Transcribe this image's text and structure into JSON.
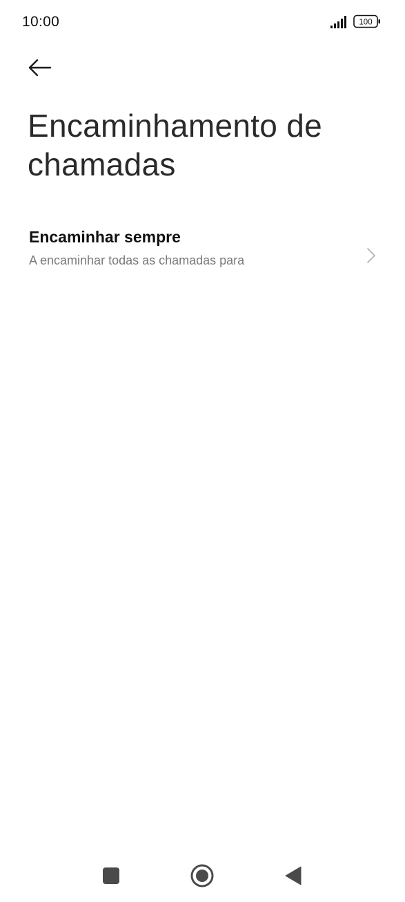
{
  "status_bar": {
    "time": "10:00",
    "signal_icon": "signal-bars-icon",
    "battery_level": "100",
    "battery_icon": "battery-icon"
  },
  "header": {
    "back_icon": "arrow-left-icon",
    "title": "Encaminhamento de chamadas"
  },
  "settings": {
    "items": [
      {
        "title": "Encaminhar sempre",
        "subtitle": "A encaminhar todas as chamadas para",
        "icon": "chevron-right-icon"
      }
    ]
  },
  "nav_bar": {
    "recents_icon": "square-icon",
    "home_icon": "circle-icon",
    "back_icon": "triangle-back-icon"
  },
  "colors": {
    "background": "#ffffff",
    "title_text": "#2a2a2a",
    "subtitle_text": "#7a7a7a",
    "nav_icon": "#4a4a4a"
  }
}
